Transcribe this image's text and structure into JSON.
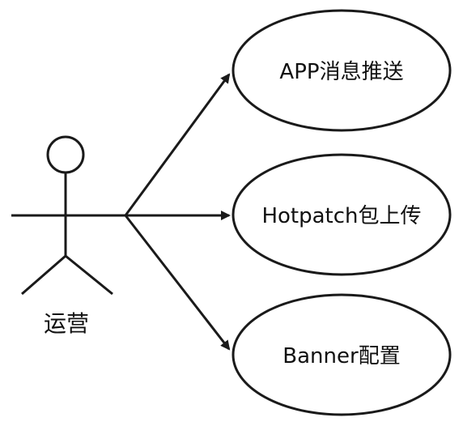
{
  "actor": {
    "label": "运营"
  },
  "use_cases": [
    {
      "label": "APP消息推送"
    },
    {
      "label": "Hotpatch包上传"
    },
    {
      "label": "Banner配置"
    }
  ],
  "colors": {
    "stroke": "#1a1a1a",
    "fill": "#ffffff",
    "text": "#111111"
  }
}
